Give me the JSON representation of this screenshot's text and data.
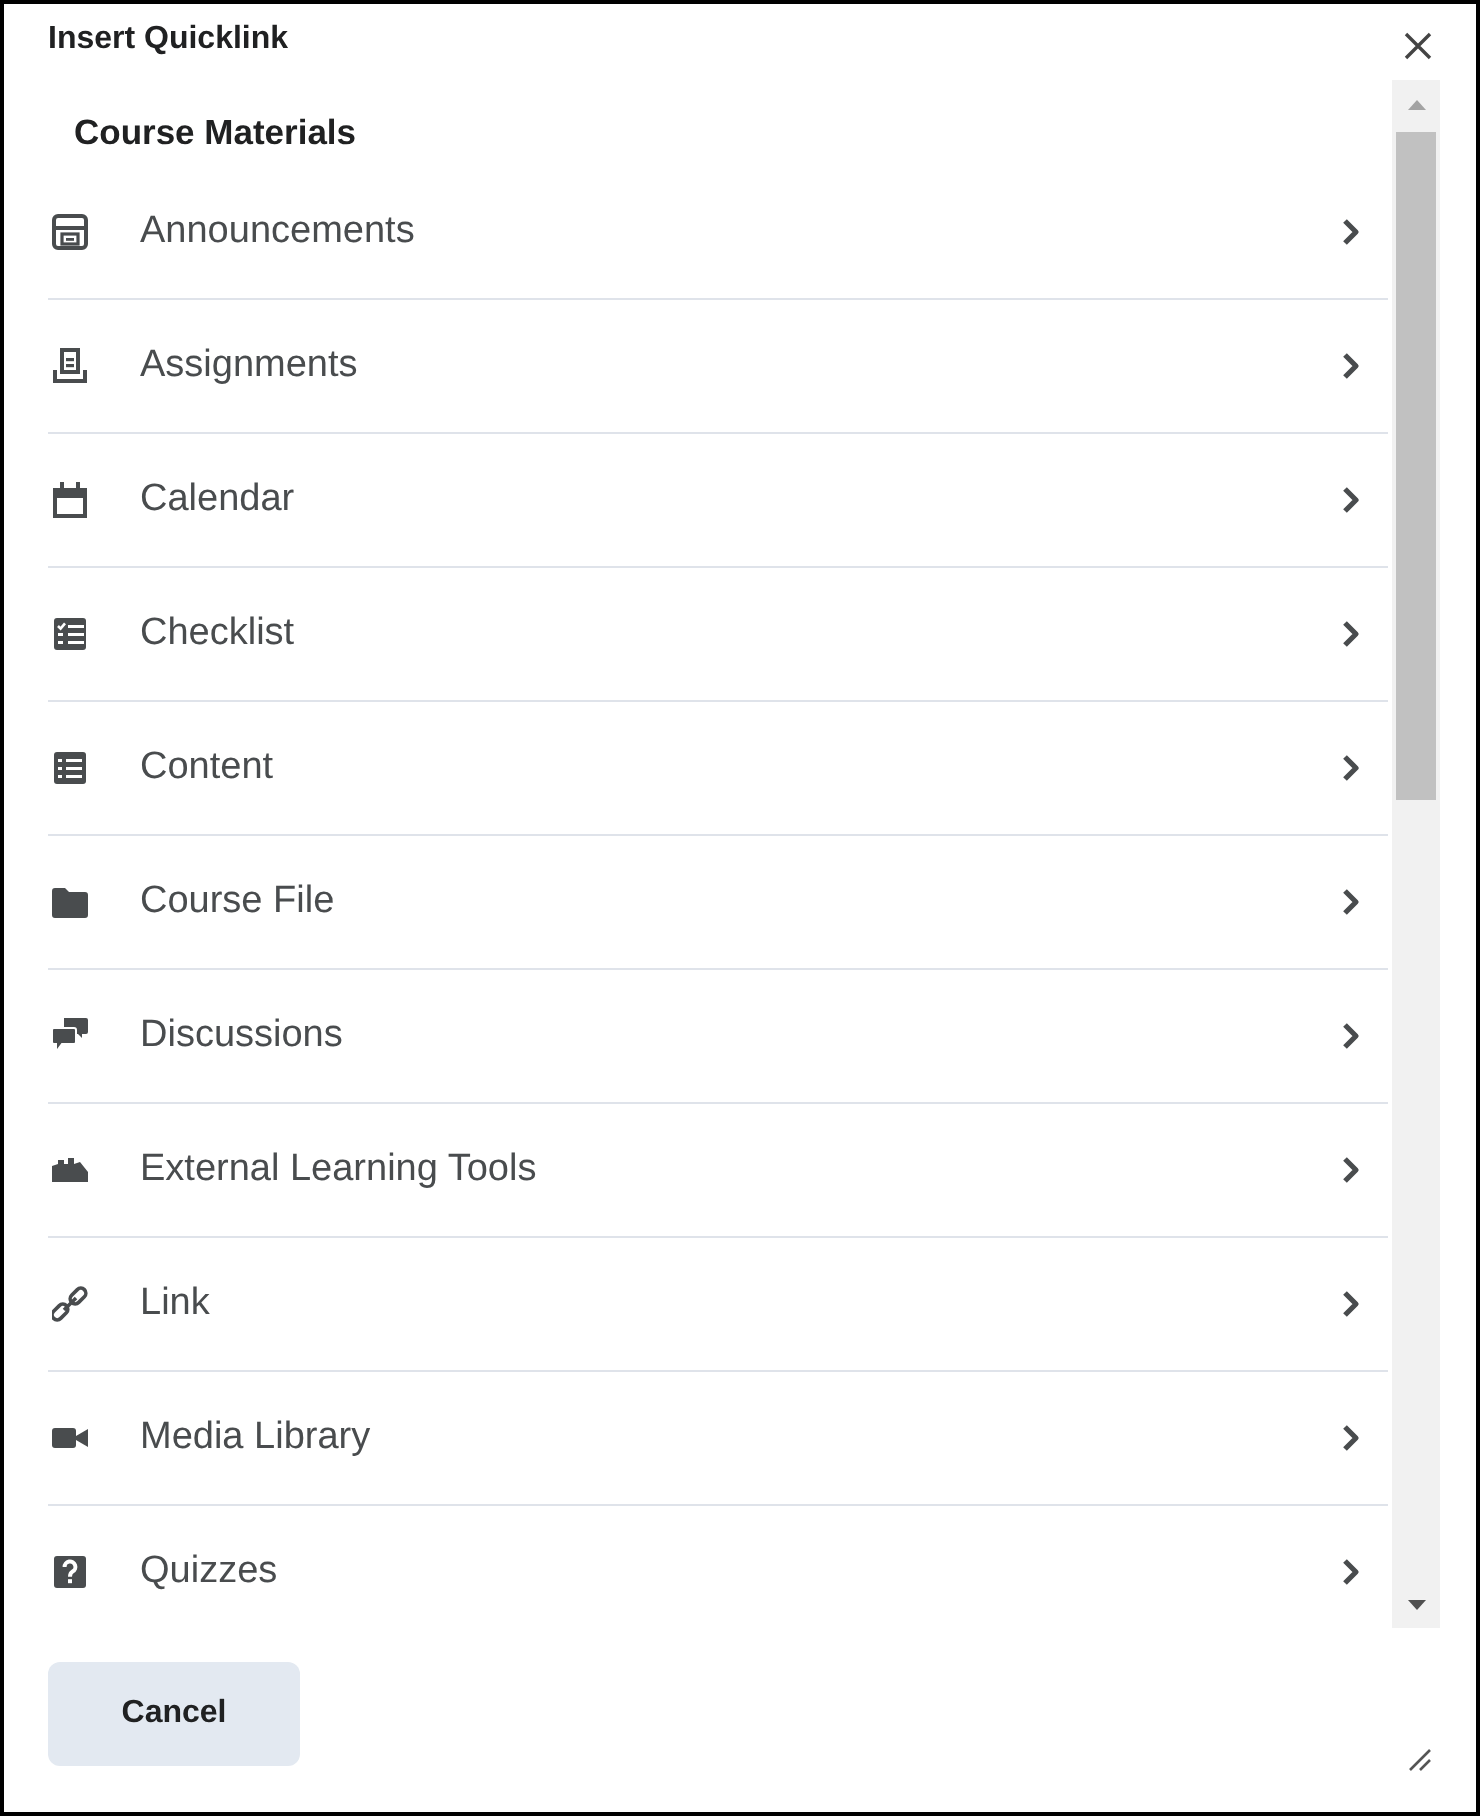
{
  "dialog": {
    "title": "Insert Quicklink"
  },
  "section": {
    "heading": "Course Materials",
    "items": [
      {
        "label": "Announcements",
        "kind": "announcements"
      },
      {
        "label": "Assignments",
        "kind": "assignments"
      },
      {
        "label": "Calendar",
        "kind": "calendar"
      },
      {
        "label": "Checklist",
        "kind": "checklist"
      },
      {
        "label": "Content",
        "kind": "content"
      },
      {
        "label": "Course File",
        "kind": "file"
      },
      {
        "label": "Discussions",
        "kind": "discussions"
      },
      {
        "label": "External Learning Tools",
        "kind": "tools"
      },
      {
        "label": "Link",
        "kind": "link"
      },
      {
        "label": "Media Library",
        "kind": "media"
      },
      {
        "label": "Quizzes",
        "kind": "quizzes"
      }
    ]
  },
  "footer": {
    "cancel_button": {
      "label": "Cancel"
    }
  }
}
